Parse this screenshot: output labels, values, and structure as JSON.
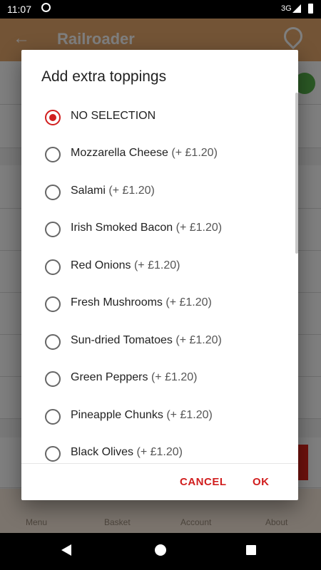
{
  "status": {
    "time": "11:07",
    "network": "3G"
  },
  "appbar": {
    "title": "Railroader"
  },
  "bottom_nav": {
    "items": [
      "Menu",
      "Basket",
      "Account",
      "About"
    ]
  },
  "dialog": {
    "title": "Add extra toppings",
    "options": [
      {
        "name": "NO SELECTION",
        "price": "",
        "selected": true
      },
      {
        "name": "Mozzarella Cheese",
        "price": "(+ £1.20)",
        "selected": false
      },
      {
        "name": "Salami",
        "price": "(+ £1.20)",
        "selected": false
      },
      {
        "name": "Irish Smoked Bacon",
        "price": "(+ £1.20)",
        "selected": false
      },
      {
        "name": "Red Onions",
        "price": "(+ £1.20)",
        "selected": false
      },
      {
        "name": "Fresh Mushrooms",
        "price": "(+ £1.20)",
        "selected": false
      },
      {
        "name": "Sun-dried Tomatoes",
        "price": "(+ £1.20)",
        "selected": false
      },
      {
        "name": "Green Peppers",
        "price": "(+ £1.20)",
        "selected": false
      },
      {
        "name": "Pineapple Chunks",
        "price": "(+ £1.20)",
        "selected": false
      },
      {
        "name": "Black Olives",
        "price": "(+ £1.20)",
        "selected": false
      }
    ],
    "cancel_label": "CANCEL",
    "ok_label": "OK"
  },
  "colors": {
    "accent": "#d11e1e",
    "appbar": "#e6a86d"
  }
}
